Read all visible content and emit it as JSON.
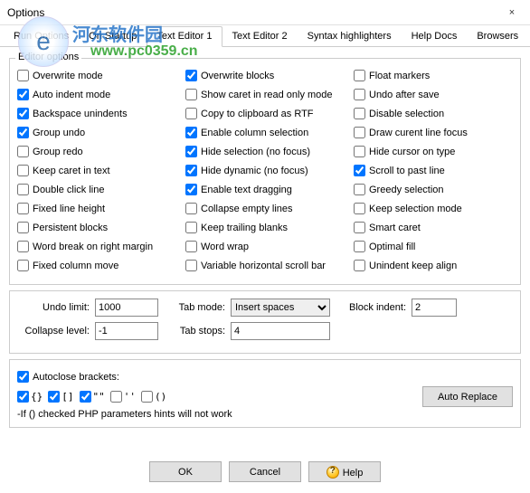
{
  "window": {
    "title": "Options",
    "close": "×"
  },
  "tabs": [
    "Run Options",
    "On Startup",
    "Text Editor 1",
    "Text Editor 2",
    "Syntax highlighters",
    "Help Docs",
    "Browsers"
  ],
  "watermark": {
    "logo": "e",
    "text": "河东软件园",
    "url": "www.pc0359.cn"
  },
  "legend": "Editor options",
  "col1": [
    {
      "k": "overwrite_mode",
      "label": "Overwrite mode",
      "checked": false
    },
    {
      "k": "auto_indent",
      "label": "Auto indent mode",
      "checked": true
    },
    {
      "k": "backspace_unindents",
      "label": "Backspace unindents",
      "checked": true
    },
    {
      "k": "group_undo",
      "label": "Group undo",
      "checked": true
    },
    {
      "k": "group_redo",
      "label": "Group redo",
      "checked": false
    },
    {
      "k": "keep_caret",
      "label": "Keep caret in text",
      "checked": false
    },
    {
      "k": "double_click_line",
      "label": "Double click line",
      "checked": false
    },
    {
      "k": "fixed_line_height",
      "label": "Fixed line height",
      "checked": false
    },
    {
      "k": "persistent_blocks",
      "label": "Persistent blocks",
      "checked": false
    },
    {
      "k": "word_break_margin",
      "label": "Word break on right margin",
      "checked": false
    },
    {
      "k": "fixed_column_move",
      "label": "Fixed column move",
      "checked": false
    }
  ],
  "col2": [
    {
      "k": "overwrite_blocks",
      "label": "Overwrite blocks",
      "checked": true
    },
    {
      "k": "show_caret_ro",
      "label": "Show caret in read only mode",
      "checked": false
    },
    {
      "k": "copy_rtf",
      "label": "Copy to clipboard as RTF",
      "checked": false
    },
    {
      "k": "enable_col_sel",
      "label": "Enable column selection",
      "checked": true
    },
    {
      "k": "hide_sel_nofocus",
      "label": "Hide selection (no focus)",
      "checked": true
    },
    {
      "k": "hide_dyn_nofocus",
      "label": "Hide dynamic (no focus)",
      "checked": true
    },
    {
      "k": "enable_text_drag",
      "label": "Enable text dragging",
      "checked": true
    },
    {
      "k": "collapse_empty",
      "label": "Collapse empty lines",
      "checked": false
    },
    {
      "k": "keep_trailing",
      "label": "Keep trailing blanks",
      "checked": false
    },
    {
      "k": "word_wrap",
      "label": "Word wrap",
      "checked": false
    },
    {
      "k": "var_hscroll",
      "label": "Variable horizontal scroll bar",
      "checked": false
    }
  ],
  "col3": [
    {
      "k": "float_markers",
      "label": "Float markers",
      "checked": false
    },
    {
      "k": "undo_after_save",
      "label": "Undo after save",
      "checked": false
    },
    {
      "k": "disable_selection",
      "label": "Disable selection",
      "checked": false
    },
    {
      "k": "draw_curline_focus",
      "label": "Draw curent line focus",
      "checked": false
    },
    {
      "k": "hide_cursor_type",
      "label": "Hide cursor on type",
      "checked": false
    },
    {
      "k": "scroll_past_line",
      "label": "Scroll to past line",
      "checked": true
    },
    {
      "k": "greedy_selection",
      "label": "Greedy selection",
      "checked": false
    },
    {
      "k": "keep_sel_mode",
      "label": "Keep selection mode",
      "checked": false
    },
    {
      "k": "smart_caret",
      "label": "Smart caret",
      "checked": false
    },
    {
      "k": "optimal_fill",
      "label": "Optimal fill",
      "checked": false
    },
    {
      "k": "unindent_keep_align",
      "label": "Unindent keep align",
      "checked": false
    }
  ],
  "settings": {
    "undo_limit_label": "Undo limit:",
    "undo_limit": "1000",
    "collapse_label": "Collapse level:",
    "collapse": "-1",
    "tab_mode_label": "Tab mode:",
    "tab_mode": "Insert spaces",
    "tab_stops_label": "Tab stops:",
    "tab_stops": "4",
    "block_indent_label": "Block indent:",
    "block_indent": "2"
  },
  "autoclose": {
    "label": "Autoclose brackets:",
    "pairs": [
      {
        "sym": "{}",
        "checked": true
      },
      {
        "sym": "[]",
        "checked": true
      },
      {
        "sym": "\"\"",
        "checked": true
      },
      {
        "sym": "''",
        "checked": false
      },
      {
        "sym": "()",
        "checked": false
      }
    ],
    "note": "-If () checked PHP parameters hints will not work",
    "auto_replace": "Auto Replace"
  },
  "buttons": {
    "ok": "OK",
    "cancel": "Cancel",
    "help": "Help"
  }
}
